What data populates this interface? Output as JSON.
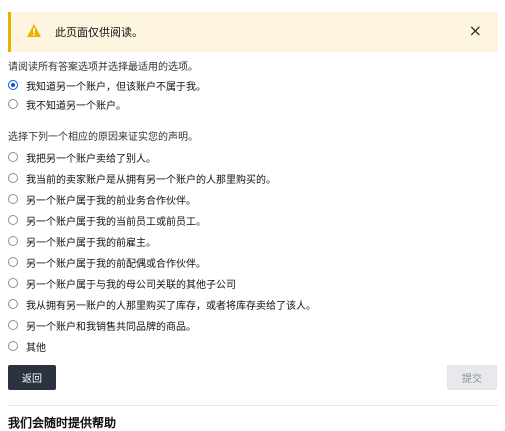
{
  "alert": {
    "message": "此页面仅供阅读。",
    "close": "×"
  },
  "q1": {
    "prompt": "请阅读所有答案选项并选择最适用的选项。",
    "options": [
      {
        "label": "我知道另一个账户，但该账户不属于我。",
        "selected": true
      },
      {
        "label": "我不知道另一个账户。",
        "selected": false
      }
    ]
  },
  "q2": {
    "prompt": "选择下列一个相应的原因来证实您的声明。",
    "options": [
      {
        "label": "我把另一个账户卖给了别人。",
        "selected": false
      },
      {
        "label": "我当前的卖家账户是从拥有另一个账户的人那里购买的。",
        "selected": false
      },
      {
        "label": "另一个账户属于我的前业务合作伙伴。",
        "selected": false
      },
      {
        "label": "另一个账户属于我的当前员工或前员工。",
        "selected": false
      },
      {
        "label": "另一个账户属于我的前雇主。",
        "selected": false
      },
      {
        "label": "另一个账户属于我的前配偶或合作伙伴。",
        "selected": false
      },
      {
        "label": "另一个账户属于与我的母公司关联的其他子公司",
        "selected": false
      },
      {
        "label": "我从拥有另一账户的人那里购买了库存，或者将库存卖给了该人。",
        "selected": false
      },
      {
        "label": "另一个账户和我销售共同品牌的商品。",
        "selected": false
      },
      {
        "label": "其他",
        "selected": false
      }
    ]
  },
  "actions": {
    "back": "返回",
    "submit": "提交"
  },
  "help": {
    "title": "我们会随时提供帮助"
  },
  "colors": {
    "alert_bg": "#fdf5e0",
    "alert_accent": "#f0b000",
    "radio_selected": "#0b57d0",
    "back_button": "#2b3340",
    "submit_disabled": "#e7e9ec"
  }
}
